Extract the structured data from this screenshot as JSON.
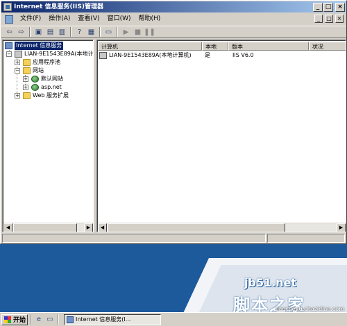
{
  "window": {
    "title": "Internet 信息服务(IIS)管理器",
    "buttons": {
      "minimize": "_",
      "maximize": "□",
      "close": "×"
    }
  },
  "menu": {
    "items": [
      "文件(F)",
      "操作(A)",
      "查看(V)",
      "窗口(W)",
      "帮助(H)"
    ],
    "right": [
      "_",
      "□",
      "×"
    ]
  },
  "toolbar": {
    "icons": [
      "back-icon",
      "forward-icon",
      "up-icon",
      "show-tree-icon",
      "properties-icon",
      "refresh-icon",
      "export-icon",
      "help-icon",
      "computer-icon",
      "start-icon",
      "stop-icon",
      "pause-icon"
    ]
  },
  "tree": {
    "root": "Internet 信息服务",
    "server": "LIAN-9E1543E89A(本地计",
    "app_pools": "应用程序池",
    "websites": "网站",
    "default_site": "默认网站",
    "aspnet": "asp.net",
    "web_ext": "Web 服务扩展"
  },
  "list": {
    "columns": [
      "计算机",
      "本地",
      "版本",
      "状况"
    ],
    "rows": [
      {
        "computer": "LIAN-9E1543E89A(本地计算机)",
        "local": "是",
        "version": "IIS V6.0",
        "status": ""
      }
    ]
  },
  "watermark": {
    "site": "jb51.net",
    "brand": "脚本之家",
    "sub": "jiaocheng.chazidian.com"
  },
  "taskbar": {
    "start": "开始",
    "task": "Internet 信息服务(I..."
  },
  "colors": {
    "titlebar": "#0a246a",
    "desktop": "#1c5a9c",
    "selection": "#0a246a"
  }
}
